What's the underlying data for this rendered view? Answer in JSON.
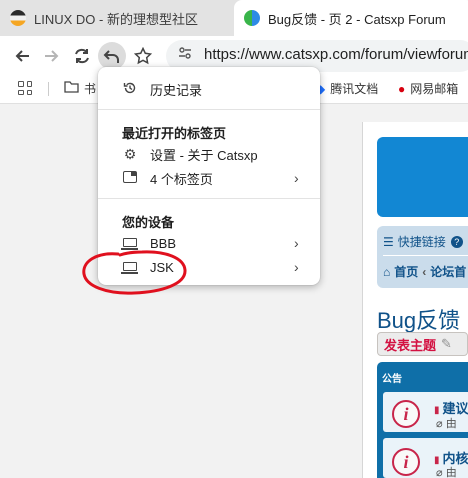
{
  "tabs": [
    {
      "title": "LINUX DO - 新的理想型社区",
      "active": false
    },
    {
      "title": "Bug反馈 - 页 2 - Catsxp Forum",
      "active": true
    }
  ],
  "toolbar": {
    "back_icon": "arrow-left-icon",
    "forward_icon": "arrow-right-icon",
    "reload_icon": "reload-icon",
    "undo_icon": "undo-icon",
    "bookmark_icon": "star-icon",
    "url": "https://www.catsxp.com/forum/viewforum"
  },
  "bookmarks": [
    {
      "label": "书",
      "icon": "folder-icon"
    },
    {
      "label": "腾讯文档",
      "icon": "tencent-docs-icon"
    },
    {
      "label": "网易邮箱",
      "icon": "netease-mail-icon"
    }
  ],
  "history_menu": {
    "history_label": "历史记录",
    "recent_heading": "最近打开的标签页",
    "recent_items": [
      {
        "label": "设置 - 关于 Catsxp",
        "icon": "gear-icon",
        "has_submenu": false
      },
      {
        "label": "4 个标签页",
        "icon": "tabs-icon",
        "has_submenu": true
      }
    ],
    "devices_heading": "您的设备",
    "devices": [
      {
        "label": "BBB",
        "icon": "laptop-icon",
        "has_submenu": true
      },
      {
        "label": "JSK",
        "icon": "laptop-icon",
        "has_submenu": true
      }
    ]
  },
  "forum": {
    "quick_links": "快捷链接",
    "breadcrumb_home": "首页",
    "breadcrumb_next": "论坛首",
    "title": "Bug反馈",
    "post_button": "发表主题",
    "announcements_header": "公告",
    "announcements": [
      {
        "title": "建议",
        "sub": "由"
      },
      {
        "title": "内核",
        "sub": "由"
      }
    ]
  },
  "colors": {
    "annotation_red": "#e0101e",
    "forum_link": "#105289",
    "forum_banner": "#1287d3",
    "post_button_text": "#d31141"
  }
}
